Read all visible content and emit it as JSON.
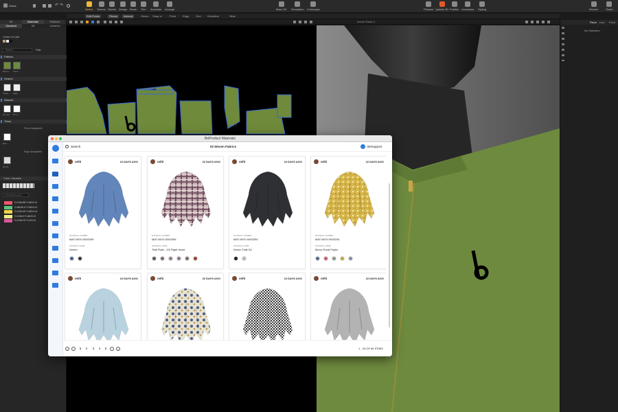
{
  "toolbar": {
    "home": "Home",
    "tools": [
      "Select",
      "Texture",
      "Sketch",
      "Design",
      "Brush",
      "Pen",
      "Annotate",
      "Arrange"
    ],
    "center": [
      "Base 3D",
      "Simulation",
      "Colorways"
    ],
    "right": [
      "Prepare",
      "Update 3D",
      "Publish",
      "Unrelease",
      "Styling"
    ],
    "far_right": [
      "Render",
      "Share"
    ]
  },
  "toolbar2": {
    "edit_points": "Edit Points",
    "pieces": "Pieces",
    "internal": "Internal",
    "items": [
      "Gizmo",
      "Snap to",
      "Point",
      "Edge",
      "Grid",
      "Guideline",
      "Slide"
    ],
    "view": "Arrow Grade 4"
  },
  "left_panel": {
    "tabs": [
      "3D",
      "Materials",
      "Patterns"
    ],
    "subtabs": [
      "Garment",
      "3D",
      "Libraries"
    ],
    "colors_in_use": "Colors In Use",
    "search_placeholder": "Search...",
    "filter": "Filter",
    "sections": [
      "Fabrics",
      "Seams",
      "Artwork",
      "Trims"
    ],
    "fabric_labels": [
      "Rib kn...",
      "Fleec..."
    ],
    "seam_labels": [
      "Single...",
      "Edge..."
    ],
    "art_labels": [
      "3D_1M...",
      "BT_0..."
    ],
    "trim_groups": [
      "Piece Assignable",
      "Edge Assignable"
    ],
    "trim_labels": [
      "BeS ...",
      "3M 0s..."
    ],
    "color_libraries": "Color Libraries",
    "color_search": "Color library gener...",
    "color_rows": [
      {
        "label": "C=0 M=80 Y=60 K=0",
        "color": "#f0566a"
      },
      {
        "label": "C=60 M=0 Y=60 K=0",
        "color": "#5ec27a"
      },
      {
        "label": "C=0 M=10 Y=80 K=0",
        "color": "#f3d54c"
      },
      {
        "label": "C=0 M=0 Y=60 K=0",
        "color": "#eeee88"
      },
      {
        "label": "C=0 M=70 Y=0 K=0",
        "color": "#d9579b"
      }
    ]
  },
  "pattern_view": {
    "sew_label": "Sew # 3"
  },
  "right_panel": {
    "tabs": [
      "Piece",
      "Line",
      "Point"
    ],
    "no_selection": "No Selection"
  },
  "modal": {
    "title": "BeProduct Materials",
    "search": "Search",
    "heading": "02 Woven Fabrics",
    "brand": "BeSupport",
    "material_number_label": "MATERIAL NUMBER",
    "material_name_label": "MATERIAL NAME",
    "cards": [
      {
        "user": "oshi",
        "ago": "22 DAYS AGO",
        "number": "MAT-WOV-0000295",
        "name": "Denim",
        "fabric": "#5a7fb5",
        "pattern": "denim",
        "swatches": [
          "#44649a",
          "#34373f"
        ]
      },
      {
        "user": "oshi",
        "ago": "22 DAYS AGO",
        "number": "MAT-WOV-0000265",
        "name": "Twill Plaid - 2/2 Right Hand",
        "fabric": "#c9b1b4",
        "pattern": "plaid",
        "swatches": [
          "#5a5a5a",
          "#7a6e72",
          "#8d8085",
          "#8d7a8e",
          "#7e6b70",
          "#9a4034"
        ]
      },
      {
        "user": "oshi",
        "ago": "22 DAYS AGO",
        "number": "MAT-WOV-0000294",
        "name": "Denim Twill 3/1",
        "fabric": "#2e3033",
        "pattern": "solid",
        "swatches": [
          "#1f1f23",
          "#b8b9bc"
        ]
      },
      {
        "user": "oshi",
        "ago": "22 DAYS AGO",
        "number": "MAT-WOV-0000234",
        "name": "Mono Floral Poplin",
        "fabric": "#d6b54a",
        "pattern": "floral",
        "swatches": [
          "#5c6a8c",
          "#c6606c",
          "#8d9b88",
          "#c7a446",
          "#8a8ea2"
        ]
      },
      {
        "user": "oshi",
        "ago": "22 DAYS AGO",
        "number": "",
        "name": "",
        "fabric": "#b9d2df",
        "pattern": "solid",
        "swatches": []
      },
      {
        "user": "oshi",
        "ago": "22 DAYS AGO",
        "number": "",
        "name": "",
        "fabric": "#e7e2cf",
        "pattern": "floral2",
        "swatches": []
      },
      {
        "user": "oshi",
        "ago": "22 DAYS AGO",
        "number": "",
        "name": "",
        "fabric": "#9a9a9a",
        "pattern": "houndstooth",
        "swatches": []
      },
      {
        "user": "oshi",
        "ago": "22 DAYS AGO",
        "number": "",
        "name": "",
        "fabric": "#b3b3b3",
        "pattern": "solid",
        "swatches": []
      }
    ],
    "pages": [
      "1",
      "2",
      "3",
      "4",
      "5"
    ],
    "items_info": "1 - 20 OF 85 ITEMS"
  }
}
